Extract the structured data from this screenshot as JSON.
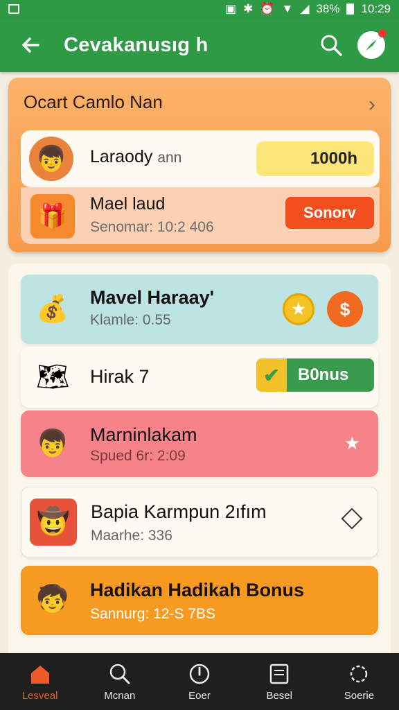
{
  "status_bar": {
    "battery_percent": "38%",
    "time": "10:29"
  },
  "app_bar": {
    "title": "Cevakanusıg h",
    "avatar_badge_color": "#e63b2e"
  },
  "top_panel": {
    "title": "Ocart Camlo Nan",
    "card_a": {
      "name": "Laraody",
      "name_suffix": "ann",
      "pill_value": "1000h"
    },
    "card_b": {
      "name": "Mael laud",
      "subtitle": "Senomar: 10:2 406",
      "button_label": "Sonorv"
    }
  },
  "list": [
    {
      "title": "Mavel Haraay'",
      "subtitle": "Klamle: 0.55",
      "icon": "coins-icon",
      "action": "dollar-coin",
      "color": "#bde3e3"
    },
    {
      "title": "Hirak 7",
      "subtitle": "",
      "icon": "map-icon",
      "action_label": "B0nus",
      "color": "#fffaf2"
    },
    {
      "title": "Marninlakam",
      "subtitle": "Spued 6r: 2:09",
      "icon": "boy-avatar-icon",
      "action": "star",
      "color": "#f7838a"
    },
    {
      "title": "Bapia Karmpun 2ıfım",
      "subtitle": "Maarhe: 336",
      "icon": "farmer-avatar-icon",
      "action": "diamond",
      "color": "#fffaf2"
    },
    {
      "title": "Hadikan Hadikah Bonus",
      "subtitle": "Sannurg: 12-S 7BS",
      "icon": "hat-boy-avatar-icon",
      "color": "#f79a22"
    }
  ],
  "bottom_nav": [
    {
      "label": "Lesveal",
      "icon": "home-icon",
      "active": true
    },
    {
      "label": "Mcnan",
      "icon": "search-icon",
      "active": false
    },
    {
      "label": "Eoer",
      "icon": "compass-icon",
      "active": false
    },
    {
      "label": "Besel",
      "icon": "document-icon",
      "active": false
    },
    {
      "label": "Soerie",
      "icon": "settings-icon",
      "active": false
    }
  ],
  "colors": {
    "primary_green": "#2e9a45",
    "accent_orange": "#ef5a2a"
  }
}
